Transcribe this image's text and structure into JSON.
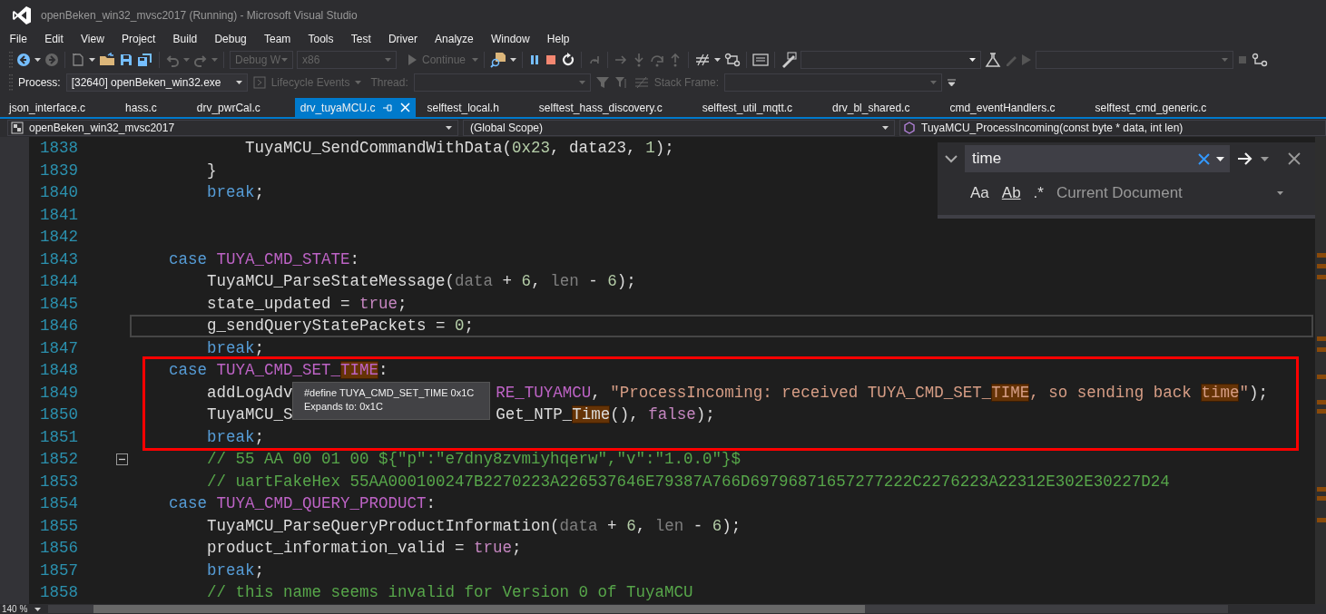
{
  "window": {
    "title": "openBeken_win32_mvsc2017 (Running) - Microsoft Visual Studio"
  },
  "menu": [
    "File",
    "Edit",
    "View",
    "Project",
    "Build",
    "Debug",
    "Team",
    "Tools",
    "Test",
    "Driver",
    "Analyze",
    "Window",
    "Help"
  ],
  "toolbar": {
    "configuration": {
      "text": "Debug W",
      "disabled": true
    },
    "platform": {
      "text": "x86",
      "disabled": true
    },
    "continue": {
      "text": "Continue",
      "disabled": true
    }
  },
  "debug_location": {
    "process_label": "Process:",
    "process": "[32640] openBeken_win32.exe",
    "lifecycle": {
      "text": "Lifecycle Events",
      "disabled": true
    },
    "thread_label": {
      "text": "Thread:",
      "disabled": true
    },
    "stack_frame_label": {
      "text": "Stack Frame:",
      "disabled": true
    }
  },
  "tabs": [
    {
      "label": "json_interface.c",
      "selected": false
    },
    {
      "label": "hass.c",
      "selected": false
    },
    {
      "label": "drv_pwrCal.c",
      "selected": false
    },
    {
      "label": "drv_tuyaMCU.c",
      "selected": true
    },
    {
      "label": "selftest_local.h",
      "selected": false
    },
    {
      "label": "selftest_hass_discovery.c",
      "selected": false
    },
    {
      "label": "selftest_util_mqtt.c",
      "selected": false
    },
    {
      "label": "drv_bl_shared.c",
      "selected": false
    },
    {
      "label": "cmd_eventHandlers.c",
      "selected": false
    },
    {
      "label": "selftest_cmd_generic.c",
      "selected": false
    }
  ],
  "nav": {
    "project": "openBeken_win32_mvsc2017",
    "scope": "(Global Scope)",
    "member": "TuyaMCU_ProcessIncoming(const byte * data, int len)"
  },
  "find": {
    "value": "time",
    "options": [
      "Aa",
      "Ab",
      ".*"
    ],
    "scope": "Current Document"
  },
  "code_lines": [
    {
      "number": "1838",
      "current": false,
      "collapsible": false,
      "tokens": [
        {
          "kind": "fn",
          "text": "            TuyaMCU_SendCommandWithData",
          "match": false
        },
        {
          "kind": "plain",
          "text": "(",
          "match": false
        },
        {
          "kind": "num",
          "text": "0x23",
          "match": false
        },
        {
          "kind": "plain",
          "text": ", data23, ",
          "match": false
        },
        {
          "kind": "num",
          "text": "1",
          "match": false
        },
        {
          "kind": "plain",
          "text": ");",
          "match": false
        }
      ]
    },
    {
      "number": "1839",
      "current": false,
      "collapsible": false,
      "tokens": [
        {
          "kind": "plain",
          "text": "        }",
          "match": false
        }
      ]
    },
    {
      "number": "1840",
      "current": false,
      "collapsible": false,
      "tokens": [
        {
          "kind": "kw",
          "text": "        break",
          "match": false
        },
        {
          "kind": "plain",
          "text": ";",
          "match": false
        }
      ]
    },
    {
      "number": "1841",
      "current": false,
      "collapsible": false
    },
    {
      "number": "1842",
      "current": false,
      "collapsible": false
    },
    {
      "number": "1843",
      "current": false,
      "collapsible": false,
      "tokens": [
        {
          "kind": "kw",
          "text": "    case ",
          "match": false
        },
        {
          "kind": "macro",
          "text": "TUYA_CMD_STATE",
          "match": false
        },
        {
          "kind": "plain",
          "text": ":",
          "match": false
        }
      ]
    },
    {
      "number": "1844",
      "current": false,
      "collapsible": false,
      "tokens": [
        {
          "kind": "fn",
          "text": "        TuyaMCU_ParseStateMessage",
          "match": false
        },
        {
          "kind": "plain",
          "text": "(",
          "match": false
        },
        {
          "kind": "param",
          "text": "data",
          "match": false
        },
        {
          "kind": "plain",
          "text": " + ",
          "match": false
        },
        {
          "kind": "num",
          "text": "6",
          "match": false
        },
        {
          "kind": "plain",
          "text": ", ",
          "match": false
        },
        {
          "kind": "param",
          "text": "len",
          "match": false
        },
        {
          "kind": "plain",
          "text": " - ",
          "match": false
        },
        {
          "kind": "num",
          "text": "6",
          "match": false
        },
        {
          "kind": "plain",
          "text": ");",
          "match": false
        }
      ]
    },
    {
      "number": "1845",
      "current": false,
      "collapsible": false,
      "tokens": [
        {
          "kind": "plain",
          "text": "        state_updated = ",
          "match": false
        },
        {
          "kind": "bool",
          "text": "true",
          "match": false
        },
        {
          "kind": "plain",
          "text": ";",
          "match": false
        }
      ]
    },
    {
      "number": "1846",
      "current": true,
      "collapsible": false,
      "tokens": [
        {
          "kind": "plain",
          "text": "        g_sendQueryStatePackets = ",
          "match": false
        },
        {
          "kind": "num",
          "text": "0",
          "match": false
        },
        {
          "kind": "plain",
          "text": ";",
          "match": false
        }
      ]
    },
    {
      "number": "1847",
      "current": false,
      "collapsible": false,
      "tokens": [
        {
          "kind": "kw",
          "text": "        break",
          "match": false
        },
        {
          "kind": "plain",
          "text": ";",
          "match": false
        }
      ]
    },
    {
      "number": "1848",
      "current": false,
      "collapsible": false,
      "tokens": [
        {
          "kind": "kw",
          "text": "    case ",
          "match": false
        },
        {
          "kind": "macro",
          "text": "TUYA_CMD_SET_",
          "match": false
        },
        {
          "kind": "macro",
          "text": "TIME",
          "match": true
        },
        {
          "kind": "plain",
          "text": ":",
          "match": false
        }
      ]
    },
    {
      "number": "1849",
      "current": false,
      "collapsible": false,
      "tokens": [
        {
          "kind": "fn",
          "text": "        addLogAdv",
          "match": false
        },
        {
          "kind": "covered"
        },
        {
          "kind": "macro",
          "text": "RE_TUYAMCU",
          "match": false
        },
        {
          "kind": "plain",
          "text": ", ",
          "match": false
        },
        {
          "kind": "str",
          "text": "\"ProcessIncoming: received TUYA_CMD_SET_",
          "match": false
        },
        {
          "kind": "str",
          "text": "TIME",
          "match": true
        },
        {
          "kind": "str",
          "text": ", so sending back ",
          "match": false
        },
        {
          "kind": "str",
          "text": "time",
          "match": true
        },
        {
          "kind": "str",
          "text": "\"",
          "match": false
        },
        {
          "kind": "plain",
          "text": ");",
          "match": false
        }
      ]
    },
    {
      "number": "1850",
      "current": false,
      "collapsible": false,
      "tokens": [
        {
          "kind": "fn",
          "text": "        TuyaMCU_S",
          "match": false
        },
        {
          "kind": "covered"
        },
        {
          "kind": "fn",
          "text": "Get_NTP_",
          "match": false
        },
        {
          "kind": "fn",
          "text": "Time",
          "match": true
        },
        {
          "kind": "plain",
          "text": "(), ",
          "match": false
        },
        {
          "kind": "bool",
          "text": "false",
          "match": false
        },
        {
          "kind": "plain",
          "text": ");",
          "match": false
        }
      ]
    },
    {
      "number": "1851",
      "current": false,
      "collapsible": false,
      "tokens": [
        {
          "kind": "kw",
          "text": "        break",
          "match": false
        },
        {
          "kind": "plain",
          "text": ";",
          "match": false
        }
      ]
    },
    {
      "number": "1852",
      "current": false,
      "collapsible": true,
      "tokens": [
        {
          "kind": "cmt",
          "text": "        // 55 AA 00 01 00 ${\"p\":\"e7dny8zvmiyhqerw\",\"v\":\"1.0.0\"}$",
          "match": false
        }
      ]
    },
    {
      "number": "1853",
      "current": false,
      "collapsible": false,
      "tokens": [
        {
          "kind": "cmt",
          "text": "        // uartFakeHex 55AA000100247B2270223A226537646E79387A766D69796871657277222C2276223A22312E302E30227D24",
          "match": false
        }
      ]
    },
    {
      "number": "1854",
      "current": false,
      "collapsible": false,
      "tokens": [
        {
          "kind": "kw",
          "text": "    case ",
          "match": false
        },
        {
          "kind": "macro",
          "text": "TUYA_CMD_QUERY_PRODUCT",
          "match": false
        },
        {
          "kind": "plain",
          "text": ":",
          "match": false
        }
      ]
    },
    {
      "number": "1855",
      "current": false,
      "collapsible": false,
      "tokens": [
        {
          "kind": "fn",
          "text": "        TuyaMCU_ParseQueryProductInformation",
          "match": false
        },
        {
          "kind": "plain",
          "text": "(",
          "match": false
        },
        {
          "kind": "param",
          "text": "data",
          "match": false
        },
        {
          "kind": "plain",
          "text": " + ",
          "match": false
        },
        {
          "kind": "num",
          "text": "6",
          "match": false
        },
        {
          "kind": "plain",
          "text": ", ",
          "match": false
        },
        {
          "kind": "param",
          "text": "len",
          "match": false
        },
        {
          "kind": "plain",
          "text": " - ",
          "match": false
        },
        {
          "kind": "num",
          "text": "6",
          "match": false
        },
        {
          "kind": "plain",
          "text": ");",
          "match": false
        }
      ]
    },
    {
      "number": "1856",
      "current": false,
      "collapsible": false,
      "tokens": [
        {
          "kind": "plain",
          "text": "        product_information_valid = ",
          "match": false
        },
        {
          "kind": "bool",
          "text": "true",
          "match": false
        },
        {
          "kind": "plain",
          "text": ";",
          "match": false
        }
      ]
    },
    {
      "number": "1857",
      "current": false,
      "collapsible": false,
      "tokens": [
        {
          "kind": "kw",
          "text": "        break",
          "match": false
        },
        {
          "kind": "plain",
          "text": ";",
          "match": false
        }
      ]
    },
    {
      "number": "1858",
      "current": false,
      "collapsible": false,
      "tokens": [
        {
          "kind": "cmt",
          "text": "        // this name seems invalid for Version 0 of TuyaMCU",
          "match": false
        }
      ]
    }
  ],
  "tooltip": {
    "lines": [
      "#define TUYA_CMD_SET_TIME 0x1C",
      "Expands to: 0x1C"
    ]
  },
  "zoom": "140 %"
}
